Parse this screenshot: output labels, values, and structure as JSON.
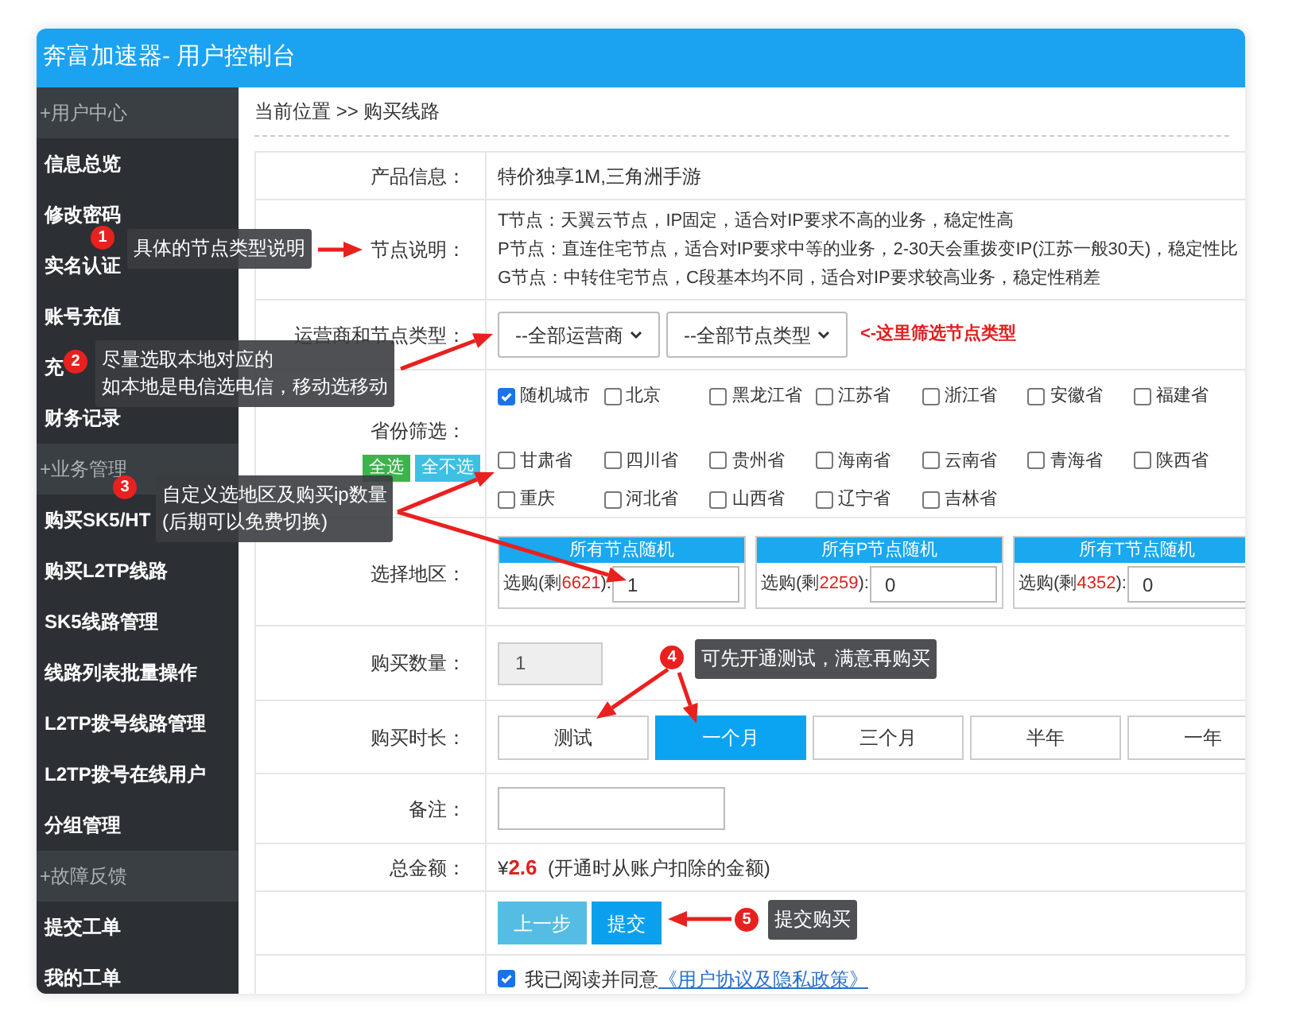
{
  "header": {
    "title": "奔富加速器- 用户控制台"
  },
  "sidebar": {
    "sections": [
      {
        "title": "+用户中心",
        "items": [
          "信息总览",
          "修改密码",
          "实名认证",
          "账号充值",
          "充",
          "财务记录"
        ]
      },
      {
        "title": "+业务管理",
        "items": [
          "购买SK5/HT",
          "购买L2TP线路",
          "SK5线路管理",
          "线路列表批量操作",
          "L2TP拨号线路管理",
          "L2TP拨号在线用户",
          "分组管理"
        ]
      },
      {
        "title": "+故障反馈",
        "items": [
          "提交工单",
          "我的工单"
        ]
      }
    ]
  },
  "breadcrumb": "当前位置 >> 购买线路",
  "form": {
    "product": {
      "label": "产品信息：",
      "value": "特价独享1M,三角洲手游"
    },
    "node_desc": {
      "label": "节点说明：",
      "lines": [
        "T节点：天翼云节点，IP固定，适合对IP要求不高的业务，稳定性高",
        "P节点：直连住宅节点，适合对IP要求中等的业务，2-30天会重拨变IP(江苏一般30天)，稳定性比",
        "G节点：中转住宅节点，C段基本均不同，适合对IP要求较高业务，稳定性稍差"
      ]
    },
    "carrier": {
      "label": "运营商和节点类型：",
      "selects": [
        "--全部运营商",
        "--全部节点类型"
      ],
      "hint": "<-这里筛选节点类型"
    },
    "provinces": {
      "label": "省份筛选：",
      "select_all": "全选",
      "select_none": "全不选",
      "rows": [
        [
          {
            "name": "随机城市",
            "checked": true
          },
          {
            "name": "北京",
            "checked": false
          },
          {
            "name": "黑龙江省",
            "checked": false
          },
          {
            "name": "江苏省",
            "checked": false
          },
          {
            "name": "浙江省",
            "checked": false
          },
          {
            "name": "安徽省",
            "checked": false
          },
          {
            "name": "福建省",
            "checked": false
          }
        ],
        [
          {
            "name": "甘肃省",
            "checked": false
          },
          {
            "name": "四川省",
            "checked": false
          },
          {
            "name": "贵州省",
            "checked": false
          },
          {
            "name": "海南省",
            "checked": false
          },
          {
            "name": "云南省",
            "checked": false
          },
          {
            "name": "青海省",
            "checked": false
          },
          {
            "name": "陕西省",
            "checked": false
          }
        ],
        [
          {
            "name": "重庆",
            "checked": false
          },
          {
            "name": "河北省",
            "checked": false
          },
          {
            "name": "山西省",
            "checked": false
          },
          {
            "name": "辽宁省",
            "checked": false
          },
          {
            "name": "吉林省",
            "checked": false
          }
        ]
      ]
    },
    "region": {
      "label": "选择地区：",
      "groups": [
        {
          "title": "所有节点随机",
          "prefix": "选购(剩",
          "remaining": "6621",
          "suffix": "):",
          "value": "1"
        },
        {
          "title": "所有P节点随机",
          "prefix": "选购(剩",
          "remaining": "2259",
          "suffix": "):",
          "value": "0"
        },
        {
          "title": "所有T节点随机",
          "prefix": "选购(剩",
          "remaining": "4352",
          "suffix": "):",
          "value": "0"
        }
      ]
    },
    "quantity": {
      "label": "购买数量：",
      "value": "1"
    },
    "duration": {
      "label": "购买时长：",
      "options": [
        {
          "label": "测试",
          "selected": false
        },
        {
          "label": "一个月",
          "selected": true
        },
        {
          "label": "三个月",
          "selected": false
        },
        {
          "label": "半年",
          "selected": false
        },
        {
          "label": "一年",
          "selected": false
        }
      ]
    },
    "note": {
      "label": "备注："
    },
    "total": {
      "label": "总金额：",
      "currency": "¥",
      "amount": "2.6",
      "note": "(开通时从账户扣除的金额)"
    },
    "buttons": [
      {
        "label": "上一步",
        "kind": "secondary"
      },
      {
        "label": "提交",
        "kind": "primary"
      }
    ],
    "agreement": {
      "checked": true,
      "text": "我已阅读并同意",
      "link": "《用户协议及隐私政策》"
    }
  },
  "annotations": [
    {
      "number": "1",
      "lines": [
        "具体的节点类型说明"
      ]
    },
    {
      "number": "2",
      "lines": [
        "尽量选取本地对应的",
        "如本地是电信选电信，移动选移动"
      ]
    },
    {
      "number": "3",
      "lines": [
        "自定义选地区及购买ip数量",
        "(后期可以免费切换)"
      ]
    },
    {
      "number": "4",
      "lines": [
        "可先开通测试，满意再购买"
      ]
    },
    {
      "number": "5",
      "lines": [
        "提交购买"
      ]
    }
  ]
}
